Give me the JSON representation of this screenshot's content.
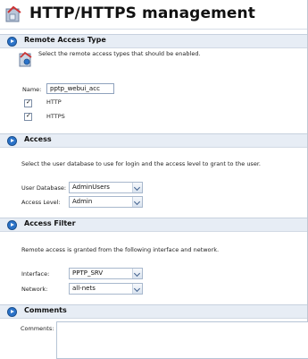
{
  "page": {
    "title": "HTTP/HTTPS management"
  },
  "sections": {
    "remote_access": {
      "heading": "Remote Access Type",
      "description": "Select the remote access types that should be enabled.",
      "name_label": "Name:",
      "name_value": "pptp_webui_acc",
      "http_label": "HTTP",
      "http_checked": true,
      "https_label": "HTTPS",
      "https_checked": true
    },
    "access": {
      "heading": "Access",
      "description": "Select the user database to use for login and the access level to grant to the user.",
      "user_db_label": "User Database:",
      "user_db_value": "AdminUsers",
      "level_label": "Access Level:",
      "level_value": "Admin"
    },
    "filter": {
      "heading": "Access Filter",
      "description": "Remote access is granted from the following interface and network.",
      "interface_label": "Interface:",
      "interface_value": "PPTP_SRV",
      "network_label": "Network:",
      "network_value": "all-nets"
    },
    "comments": {
      "heading": "Comments",
      "comments_label": "Comments:",
      "comments_value": ""
    }
  },
  "icons": {
    "title": "management-icon",
    "section_arrow": "arrow-right-circle-icon",
    "select_arrow": "chevron-down-icon",
    "checkbox_tick": "check-icon"
  }
}
